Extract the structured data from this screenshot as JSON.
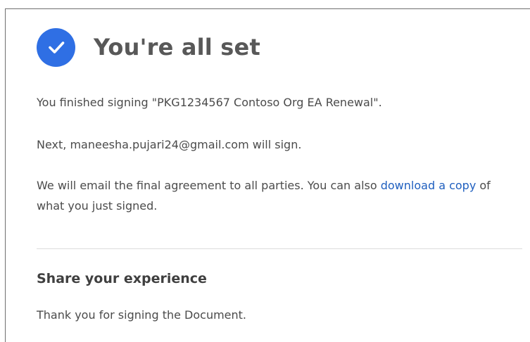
{
  "header": {
    "title": "You're all set",
    "icon": "check-circle-icon",
    "icon_color": "#2f6fe4"
  },
  "body": {
    "signed_message": "You finished signing \"PKG1234567 Contoso Org EA Renewal\".",
    "next_message": "Next, maneesha.pujari24@gmail.com will sign.",
    "email_line_before": "We will email the final agreement to all parties. You can also ",
    "download_link": "download a copy",
    "email_line_after": " of",
    "email_line_2": "what you just signed.",
    "link_color": "#1f5fbf"
  },
  "share": {
    "heading": "Share your experience",
    "thanks": "Thank you for signing the Document."
  }
}
